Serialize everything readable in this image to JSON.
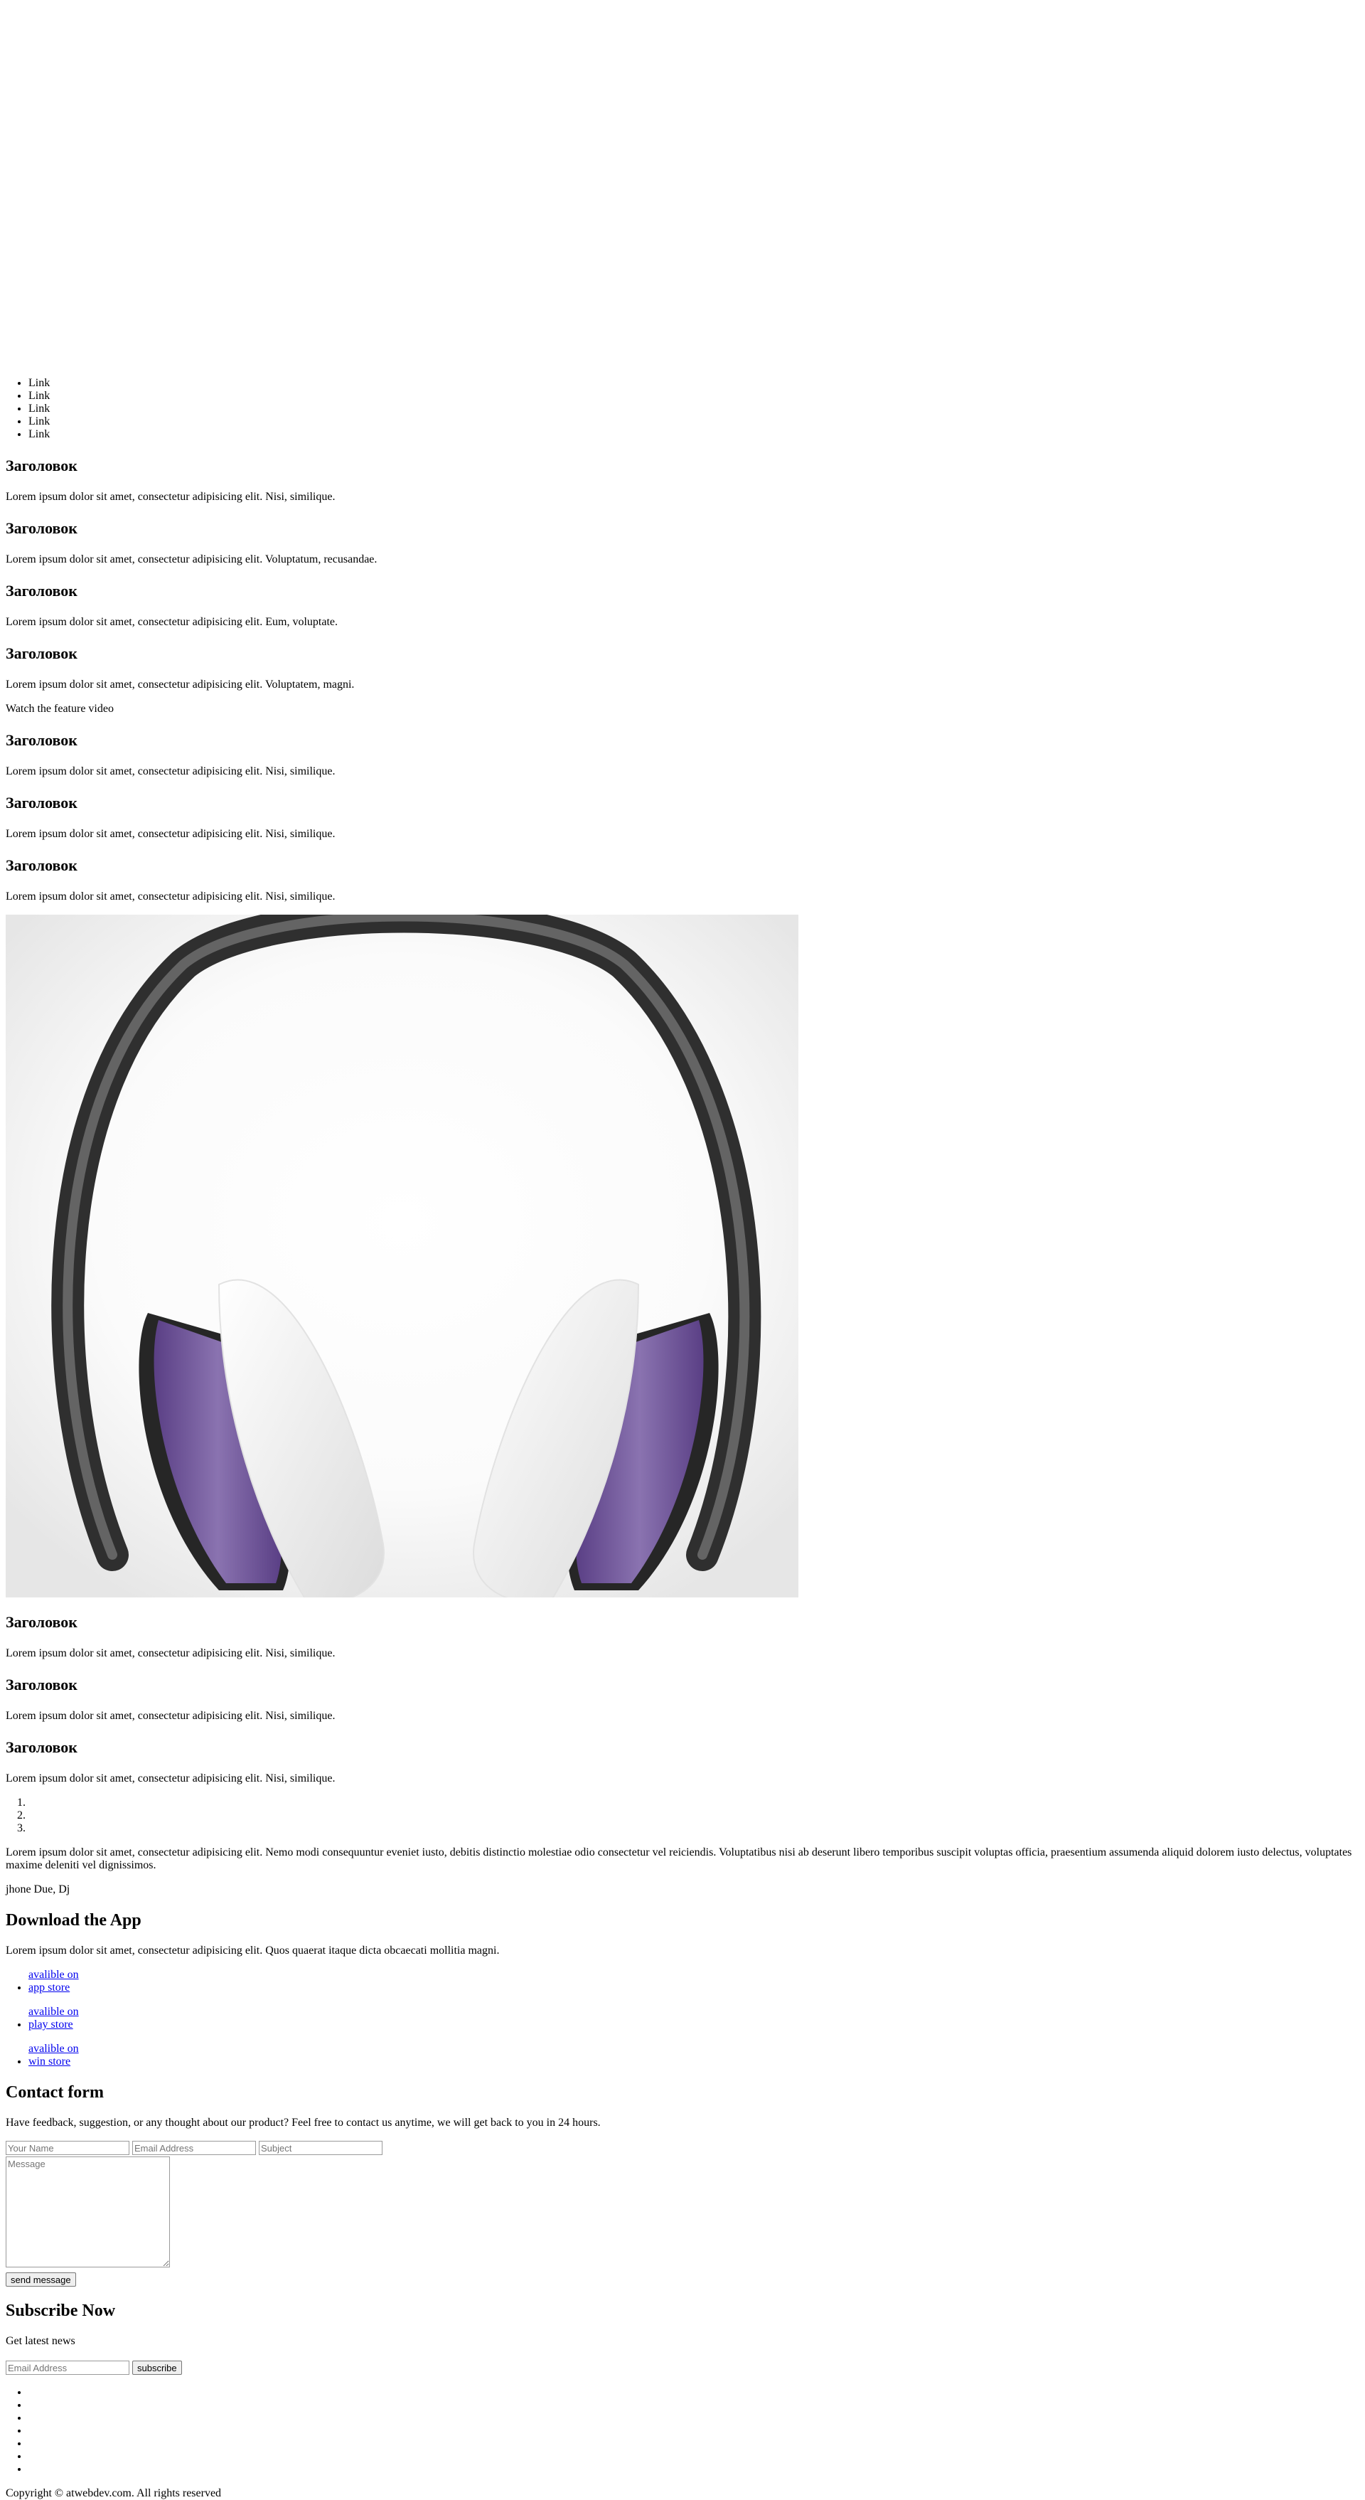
{
  "nav": {
    "links": [
      "Link",
      "Link",
      "Link",
      "Link",
      "Link"
    ]
  },
  "features_top": [
    {
      "title": "Заголовок",
      "text": "Lorem ipsum dolor sit amet, consectetur adipisicing elit. Nisi, similique."
    },
    {
      "title": "Заголовок",
      "text": "Lorem ipsum dolor sit amet, consectetur adipisicing elit. Voluptatum, recusandae."
    },
    {
      "title": "Заголовок",
      "text": "Lorem ipsum dolor sit amet, consectetur adipisicing elit. Eum, voluptate."
    },
    {
      "title": "Заголовок",
      "text": "Lorem ipsum dolor sit amet, consectetur adipisicing elit. Voluptatem, magni."
    }
  ],
  "video": {
    "label": "Watch the feature video"
  },
  "features_middle": [
    {
      "title": "Заголовок",
      "text": "Lorem ipsum dolor sit amet, consectetur adipisicing elit. Nisi, similique."
    },
    {
      "title": "Заголовок",
      "text": "Lorem ipsum dolor sit amet, consectetur adipisicing elit. Nisi, similique."
    },
    {
      "title": "Заголовок",
      "text": "Lorem ipsum dolor sit amet, consectetur adipisicing elit. Nisi, similique."
    }
  ],
  "colors": {
    "headband": "#3c3c3c",
    "ear_pad": "#f2f2f2",
    "accent_ring": "#6a4e93",
    "link": "#0000ee"
  },
  "features_bottom": [
    {
      "title": "Заголовок",
      "text": "Lorem ipsum dolor sit amet, consectetur adipisicing elit. Nisi, similique."
    },
    {
      "title": "Заголовок",
      "text": "Lorem ipsum dolor sit amet, consectetur adipisicing elit. Nisi, similique."
    },
    {
      "title": "Заголовок",
      "text": "Lorem ipsum dolor sit amet, consectetur adipisicing elit. Nisi, similique."
    }
  ],
  "testimonial": {
    "text": "Lorem ipsum dolor sit amet, consectetur adipisicing elit. Nemo modi consequuntur eveniet iusto, debitis distinctio molestiae odio consectetur vel reiciendis. Voluptatibus nisi ab deserunt libero temporibus suscipit voluptas officia, praesentium assumenda aliquid dolorem iusto delectus, voluptates maxime deleniti vel dignissimos.",
    "author": "jhone Due, Dj"
  },
  "download": {
    "title": "Download the App",
    "text": "Lorem ipsum dolor sit amet, consectetur adipisicing elit. Quos quaerat itaque dicta obcaecati mollitia magni.",
    "stores": [
      {
        "line1": "avalible on",
        "line2": "app store"
      },
      {
        "line1": "avalible on",
        "line2": "play store"
      },
      {
        "line1": "avalible on",
        "line2": "win store"
      }
    ]
  },
  "contact": {
    "title": "Contact form",
    "text": "Have feedback, suggestion, or any thought about our product? Feel free to contact us anytime, we will get back to you in 24 hours.",
    "name_placeholder": "Your Name",
    "email_placeholder": "Email Address",
    "subject_placeholder": "Subject",
    "message_placeholder": "Message",
    "submit_label": "send message"
  },
  "subscribe": {
    "title": "Subscribe Now",
    "text": "Get latest news",
    "email_placeholder": "Email Address",
    "button_label": "subscribe"
  },
  "footer": {
    "copyright": "Copyright © atwebdev.com. All rights reserved"
  }
}
